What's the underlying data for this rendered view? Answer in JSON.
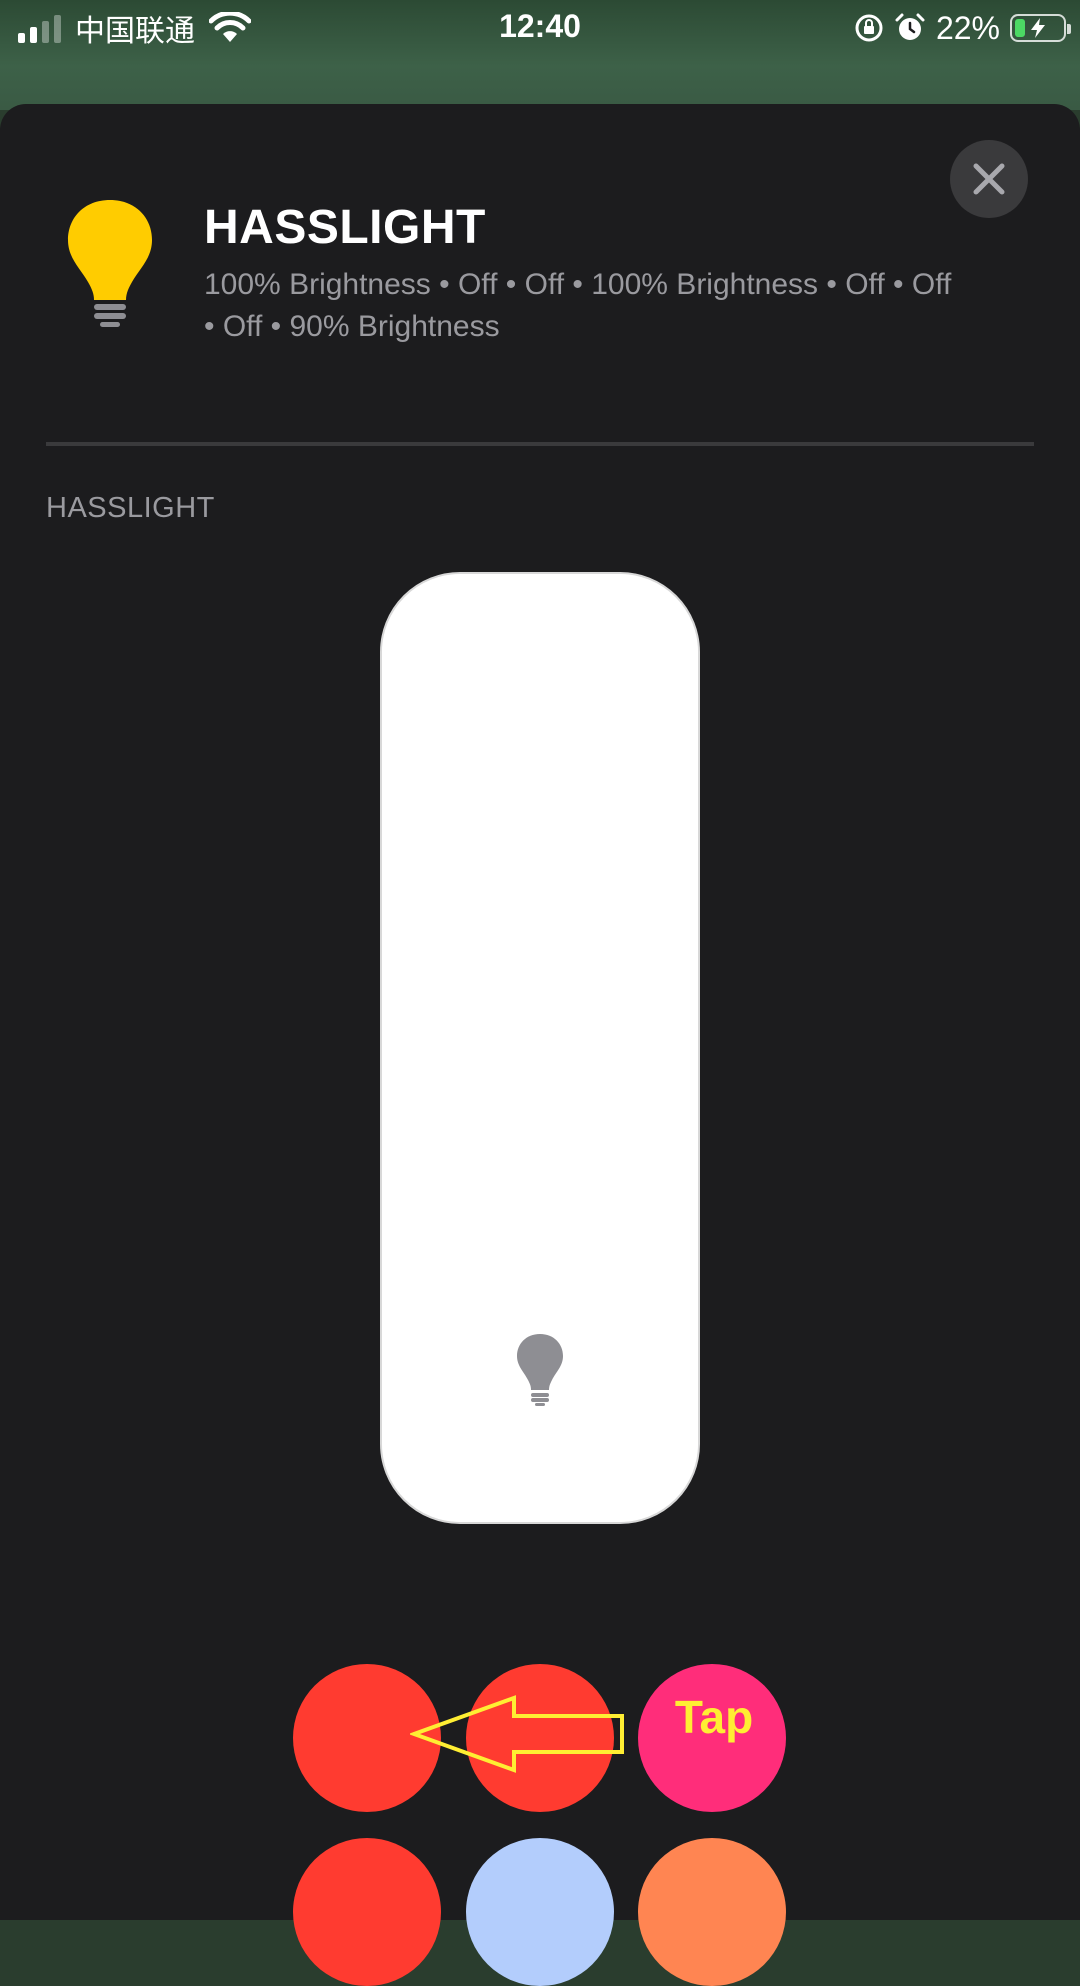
{
  "status_bar": {
    "carrier": "中国联通",
    "time": "12:40",
    "battery_percent": "22%",
    "battery_level": 0.22,
    "icons": [
      "signal-icon",
      "wifi-icon",
      "rotation-lock-icon",
      "alarm-icon",
      "battery-charging-icon"
    ]
  },
  "accessory": {
    "name": "HASSLIGHT",
    "status": "100% Brightness • Off • Off • 100% Brightness • Off • Off • Off • 90% Brightness",
    "icon": "lightbulb-icon",
    "icon_color": "#ffcc00"
  },
  "section": {
    "label": "HASSLIGHT"
  },
  "brightness_slider": {
    "level": 1.0,
    "icon": "lightbulb-icon"
  },
  "color_swatches": [
    {
      "color": "#ff3b30"
    },
    {
      "color": "#ff3b30"
    },
    {
      "color": "#ff2d7a"
    },
    {
      "color": "#ff3b30"
    },
    {
      "color": "#b3cdfc"
    },
    {
      "color": "#ff8552"
    }
  ],
  "annotation": {
    "text": "Tap",
    "color": "#ffee33"
  }
}
